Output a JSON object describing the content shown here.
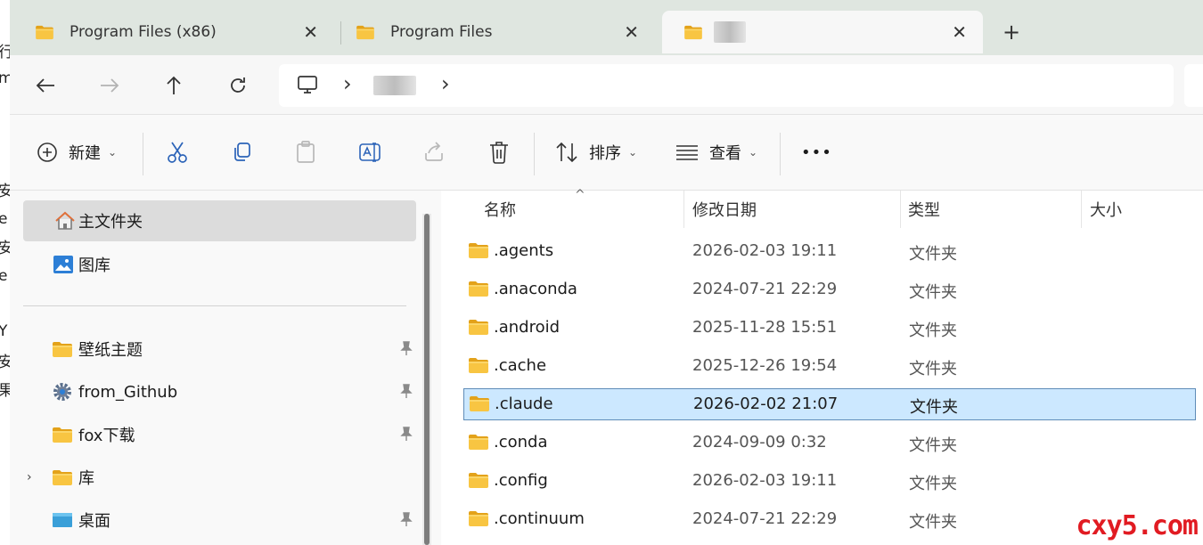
{
  "background_window": {
    "fragments": [
      "行",
      "m",
      "安",
      "e",
      "安",
      "e",
      "Y",
      "安",
      "果"
    ]
  },
  "tabs": [
    {
      "label": "Program Files (x86)",
      "active": false
    },
    {
      "label": "Program Files",
      "active": false
    },
    {
      "label": "",
      "active": true
    }
  ],
  "nav": {
    "address_separator": "›"
  },
  "toolbar": {
    "new_label": "新建",
    "sort_label": "排序",
    "view_label": "查看",
    "more_label": "•••"
  },
  "sidebar": {
    "items": [
      {
        "label": "主文件夹",
        "icon": "home-icon",
        "pinned": false,
        "selected": true
      },
      {
        "label": "图库",
        "icon": "gallery-icon",
        "pinned": false
      },
      {
        "label": "壁纸主题",
        "icon": "folder-icon",
        "pinned": true
      },
      {
        "label": "from_Github",
        "icon": "settings-folder-icon",
        "pinned": true
      },
      {
        "label": "fox下载",
        "icon": "folder-icon",
        "pinned": true
      },
      {
        "label": "库",
        "icon": "folder-icon",
        "pinned": false,
        "expandable": true
      },
      {
        "label": "桌面",
        "icon": "desktop-icon",
        "pinned": true
      }
    ]
  },
  "columns": {
    "name": "名称",
    "modified": "修改日期",
    "type": "类型",
    "size": "大小"
  },
  "files": [
    {
      "name": ".agents",
      "modified": "2026-02-03 19:11",
      "type": "文件夹"
    },
    {
      "name": ".anaconda",
      "modified": "2024-07-21 22:29",
      "type": "文件夹"
    },
    {
      "name": ".android",
      "modified": "2025-11-28 15:51",
      "type": "文件夹"
    },
    {
      "name": ".cache",
      "modified": "2025-12-26 19:54",
      "type": "文件夹"
    },
    {
      "name": ".claude",
      "modified": "2026-02-02 21:07",
      "type": "文件夹",
      "selected": true
    },
    {
      "name": ".conda",
      "modified": "2024-09-09 0:32",
      "type": "文件夹"
    },
    {
      "name": ".config",
      "modified": "2026-02-03 19:11",
      "type": "文件夹"
    },
    {
      "name": ".continuum",
      "modified": "2024-07-21 22:29",
      "type": "文件夹"
    }
  ],
  "watermark": "cxy5.com",
  "colors": {
    "selection_bg": "#cce8ff",
    "selection_border": "#5f8cb8",
    "folder": "#f8c542",
    "watermark": "#e11b22",
    "tabbar": "#dfe6e0"
  }
}
